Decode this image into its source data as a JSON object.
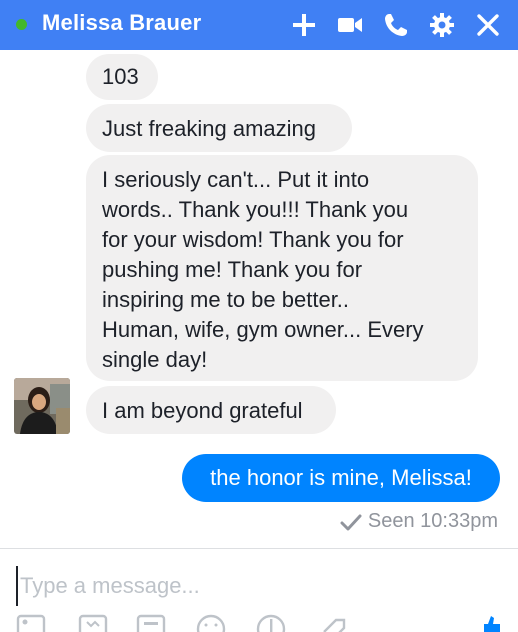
{
  "header": {
    "contact_name": "Melissa Brauer",
    "status": "online",
    "accent_color": "#4080f4",
    "icons": [
      "plus-icon",
      "video-camera-icon",
      "phone-icon",
      "gear-icon",
      "close-icon"
    ]
  },
  "messages": [
    {
      "from": "contact",
      "text": "103"
    },
    {
      "from": "contact",
      "text": "Just freaking amazing"
    },
    {
      "from": "contact",
      "lines": [
        "I seriously can't... Put it into",
        "words.. Thank you!!! Thank you",
        "for your wisdom! Thank you for",
        "pushing me! Thank you for",
        "inspiring me to be better..",
        "Human, wife, gym owner... Every",
        "single day!"
      ]
    },
    {
      "from": "contact",
      "text": "I am beyond grateful"
    },
    {
      "from": "me",
      "text": "the honor is mine, Melissa!"
    }
  ],
  "receipt": {
    "text": "Seen 10:33pm",
    "icon": "checkmark-icon"
  },
  "composer": {
    "placeholder": "Type a message...",
    "value": "",
    "tools": [
      "photo-icon",
      "sticker-icon",
      "gif-icon",
      "emoji-icon",
      "payment-icon",
      "tag-icon",
      "thumbs-up-icon"
    ]
  },
  "colors": {
    "incoming_bubble": "#f1f0f0",
    "outgoing_bubble": "#0084ff",
    "online": "#42b72a"
  }
}
